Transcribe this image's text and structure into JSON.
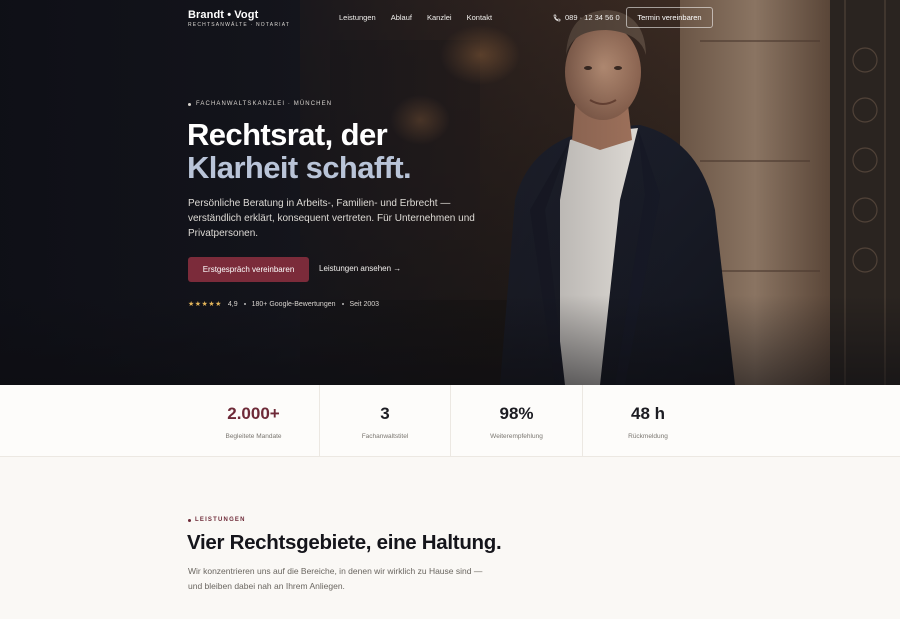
{
  "brand": {
    "name": "Brandt • Vogt",
    "subtitle": "RECHTSANWÄLTE · NOTARIAT"
  },
  "nav": {
    "links": [
      "Leistungen",
      "Ablauf",
      "Kanzlei",
      "Kontakt"
    ],
    "phone": "089 · 12 34 56 0",
    "cta": "Termin vereinbaren"
  },
  "hero": {
    "eyebrow": "FACHANWALTSKANZLEI · MÜNCHEN",
    "title_line1": "Rechtsrat, der",
    "title_line2": "Klarheit schafft.",
    "lead": "Persönliche Beratung in Arbeits-, Familien- und Erbrecht — verständlich erklärt, konsequent vertreten. Für Unternehmen und Privatpersonen.",
    "primary_button": "Erstgespräch vereinbaren",
    "secondary_link": "Leistungen ansehen →",
    "stars": "★★★★★",
    "rating_value": "4,9",
    "reviews": "180+ Google-Bewertungen",
    "since": "Seit 2003"
  },
  "stats": [
    {
      "value": "2.000+",
      "label": "Begleitete Mandate"
    },
    {
      "value": "3",
      "label": "Fachanwaltstitel"
    },
    {
      "value": "98%",
      "label": "Weiterempfehlung"
    },
    {
      "value": "48 h",
      "label": "Rückmeldung"
    }
  ],
  "services": {
    "eyebrow": "LEISTUNGEN",
    "title": "Vier Rechtsgebiete, eine Haltung.",
    "text": "Wir konzentrieren uns auf die Bereiche, in denen wir wirklich zu Hause sind — und bleiben dabei nah an Ihrem Anliegen."
  },
  "colors": {
    "accent": "#7b2b3a",
    "hero_dark": "#15161d",
    "title_light": "#b9c4d8",
    "star": "#e2b45a"
  },
  "icons": {
    "phone": "phone-icon",
    "bullet": "dot-icon",
    "rating": "star-icon"
  }
}
